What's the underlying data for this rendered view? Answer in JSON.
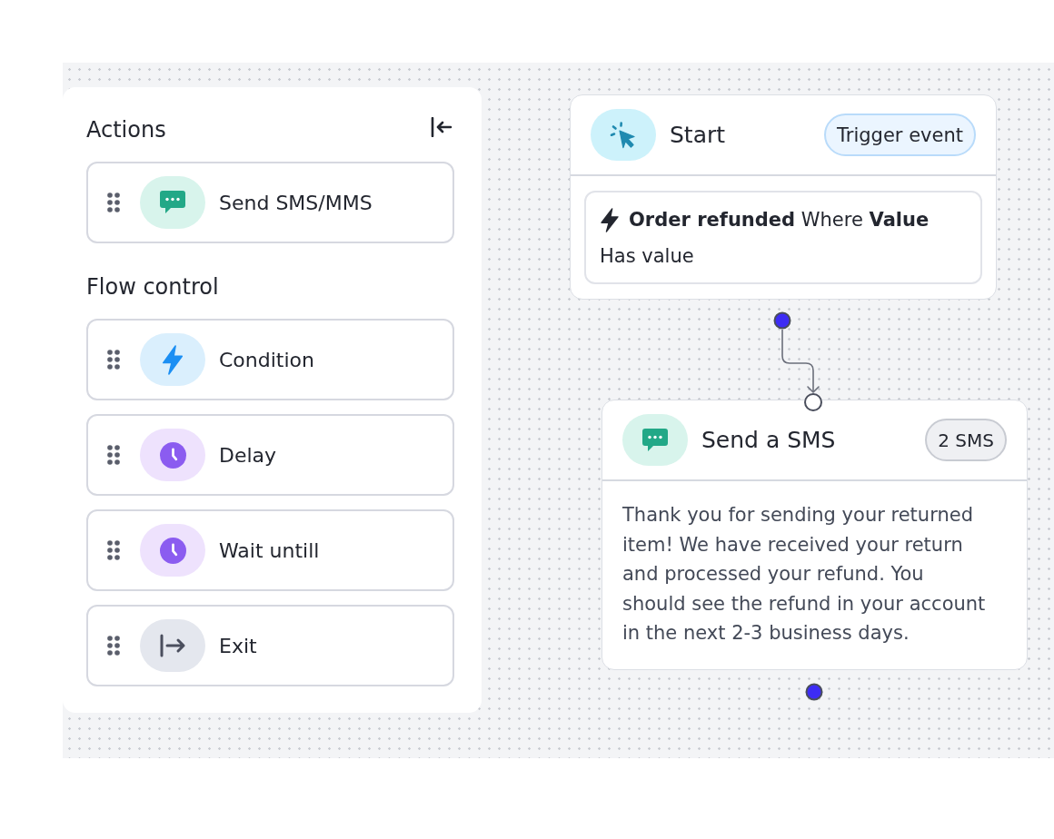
{
  "sidebar": {
    "sections": [
      {
        "title": "Actions",
        "items": [
          {
            "kind": "sms",
            "label": "Send SMS/MMS"
          }
        ]
      },
      {
        "title": "Flow control",
        "items": [
          {
            "kind": "condition",
            "label": "Condition"
          },
          {
            "kind": "delay",
            "label": "Delay"
          },
          {
            "kind": "wait",
            "label": "Wait untill"
          },
          {
            "kind": "exit",
            "label": "Exit"
          }
        ]
      }
    ]
  },
  "canvas": {
    "nodes": [
      {
        "kind": "trigger",
        "title": "Start",
        "badge": "Trigger event",
        "condition": "**Order refunded** Where **Value**",
        "detail": "Has value"
      },
      {
        "kind": "sms",
        "title": "Send a SMS",
        "badge": "2 SMS",
        "message": "Thank you for sending your returned item! We have received your return and processed your refund. You should see the refund in your account in the next 2-3 business days."
      }
    ]
  }
}
